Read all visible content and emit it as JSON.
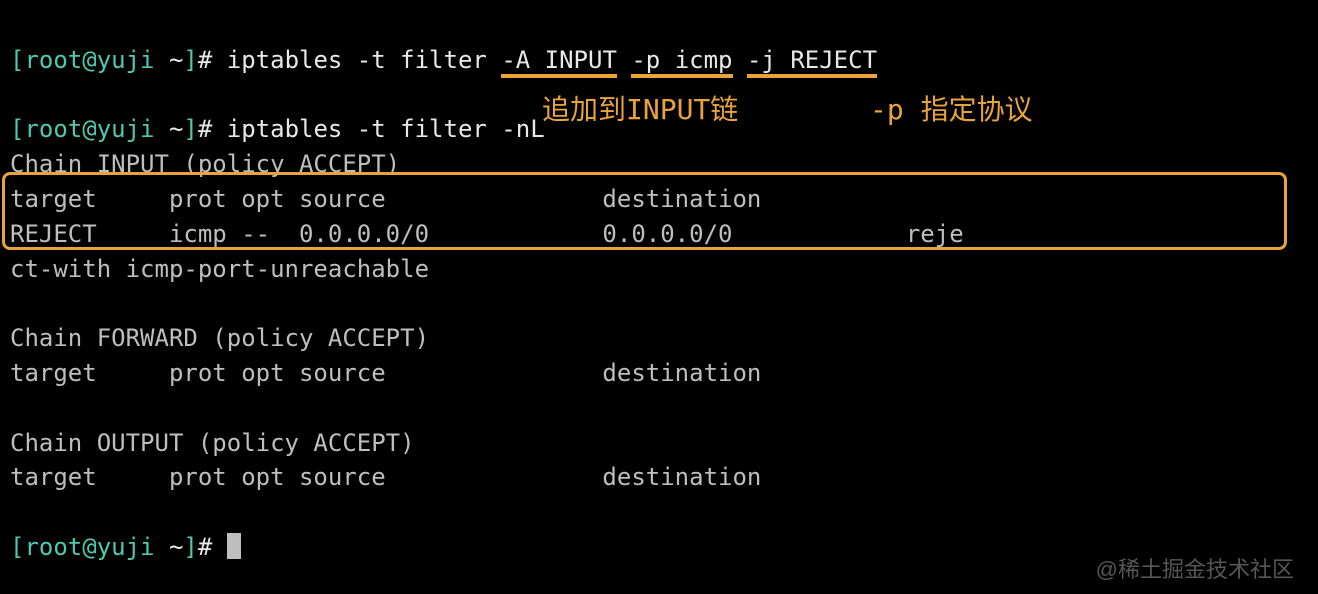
{
  "prompt": {
    "open": "[",
    "user_host": "root@yuji",
    "path": " ~",
    "close": "]",
    "symbol": "# "
  },
  "cmd1": {
    "base": "iptables -t filter ",
    "flag_a": "-A INPUT",
    "sep1": " ",
    "flag_p": "-p icmp",
    "sep2": " ",
    "flag_j": "-j REJECT"
  },
  "cmd2": "iptables -t filter -nL",
  "annotation1": "追加到INPUT链",
  "annotation2": "-p 指定协议",
  "chain_input": {
    "header": "Chain INPUT (policy ACCEPT)",
    "cols": "target     prot opt source               destination",
    "row1a": "REJECT     icmp --  0.0.0.0/0            0.0.0.0/0            reje",
    "row1b": "ct-with icmp-port-unreachable"
  },
  "chain_forward": {
    "header": "Chain FORWARD (policy ACCEPT)",
    "cols": "target     prot opt source               destination"
  },
  "chain_output": {
    "header": "Chain OUTPUT (policy ACCEPT)",
    "cols": "target     prot opt source               destination"
  },
  "watermark": "@稀土掘金技术社区"
}
